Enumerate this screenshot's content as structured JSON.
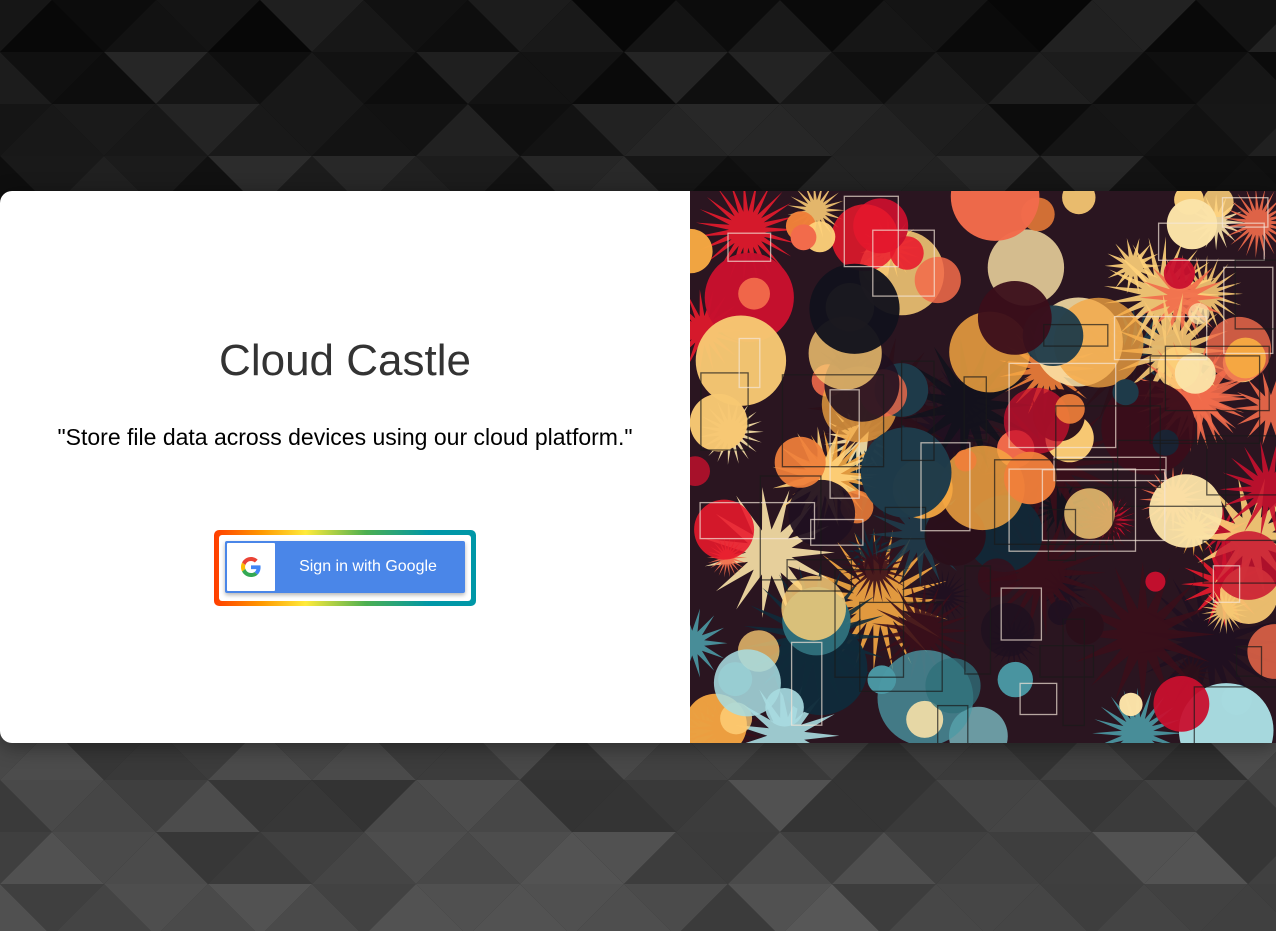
{
  "app": {
    "title": "Cloud Castle",
    "tagline": "\"Store file data across devices using our cloud platform.\""
  },
  "signin": {
    "label": "Sign in with Google",
    "icon": "google-g-icon",
    "button_color": "#4a86e8"
  },
  "colors": {
    "background": "#111111",
    "card": "#ffffff",
    "title": "#333333"
  },
  "hero_image": {
    "description_icon": "abstract-art-image"
  }
}
